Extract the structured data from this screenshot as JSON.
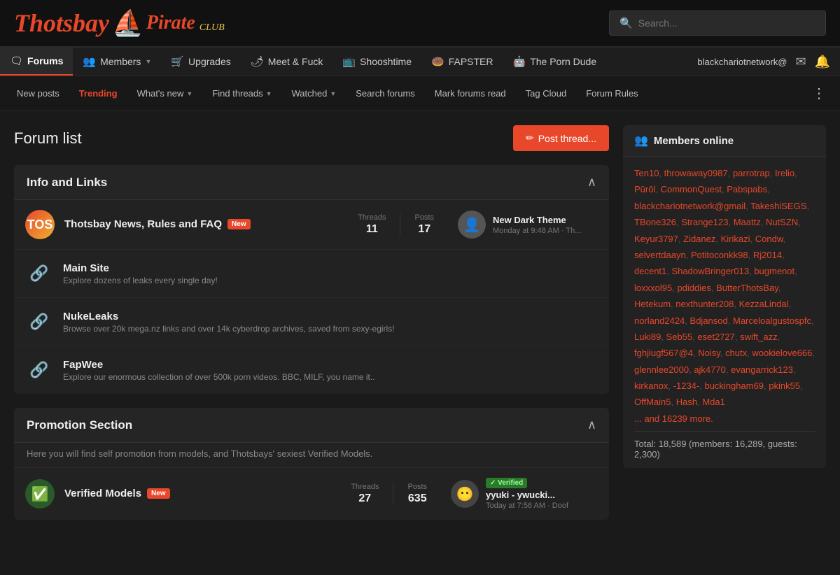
{
  "header": {
    "logo_part1": "Thotsbay",
    "logo_part2": "Pirate",
    "logo_part3": "CLUB",
    "search_placeholder": "Search..."
  },
  "navbar": {
    "items": [
      {
        "id": "forums",
        "label": "Forums",
        "icon": "🗨",
        "active": true
      },
      {
        "id": "members",
        "label": "Members",
        "icon": "👥",
        "has_arrow": true
      },
      {
        "id": "upgrades",
        "label": "Upgrades",
        "icon": "🛒"
      },
      {
        "id": "meet-fuck",
        "label": "Meet & Fuck",
        "icon": "🌶"
      },
      {
        "id": "shooshtime",
        "label": "Shooshtime",
        "icon": "📺"
      },
      {
        "id": "fapster",
        "label": "FAPSTER",
        "icon": "🍩"
      },
      {
        "id": "porn-dude",
        "label": "The Porn Dude",
        "icon": "🤖"
      }
    ],
    "username": "blackchariotnetwork@"
  },
  "sub_navbar": {
    "items": [
      {
        "id": "new-posts",
        "label": "New posts"
      },
      {
        "id": "trending",
        "label": "Trending",
        "active": true
      },
      {
        "id": "whats-new",
        "label": "What's new",
        "has_arrow": true
      },
      {
        "id": "find-threads",
        "label": "Find threads",
        "has_arrow": true
      },
      {
        "id": "watched",
        "label": "Watched",
        "has_arrow": true
      },
      {
        "id": "search-forums",
        "label": "Search forums"
      },
      {
        "id": "mark-read",
        "label": "Mark forums read"
      },
      {
        "id": "tag-cloud",
        "label": "Tag Cloud"
      },
      {
        "id": "forum-rules",
        "label": "Forum Rules"
      }
    ]
  },
  "page": {
    "title": "Forum list",
    "post_thread_btn": "Post thread..."
  },
  "sections": [
    {
      "id": "info-links",
      "title": "Info and Links",
      "collapsed": false,
      "forums": [
        {
          "id": "thotsbay-news",
          "name": "Thotsbay News, Rules and FAQ",
          "badge": "New",
          "threads": 11,
          "posts": 17,
          "latest_title": "New Dark Theme",
          "latest_meta": "Monday at 9:48 AM · Th...",
          "icon_type": "thotsb"
        }
      ],
      "links": [
        {
          "id": "main-site",
          "name": "Main Site",
          "desc": "Explore dozens of leaks every single day!"
        },
        {
          "id": "nukeleaks",
          "name": "NukeLeaks",
          "desc": "Browse over 20k mega.nz links and over 14k cyberdrop archives, saved from sexy-egirls!"
        },
        {
          "id": "fapwee",
          "name": "FapWee",
          "desc": "Explore our enormous collection of over 500k porn videos. BBC, MILF, you name it.."
        }
      ]
    },
    {
      "id": "promotion",
      "title": "Promotion Section",
      "desc": "Here you will find self promotion from models, and Thotsbays' sexiest Verified Models.",
      "collapsed": false,
      "forums": [
        {
          "id": "verified-models",
          "name": "Verified Models",
          "badge": "New",
          "threads": 27,
          "posts": 635,
          "latest_title": "yyuki - ywucki...",
          "latest_meta": "Today at 7:56 AM · Doof",
          "badge_type": "verified",
          "icon_type": "verified"
        }
      ]
    }
  ],
  "sidebar": {
    "members_online": {
      "title": "Members online",
      "members": [
        "Ten10",
        "throwaway0987",
        "parrotrap",
        "Irelio",
        "Pūrōl",
        "CommonQuest",
        "Pabspabs",
        "blackchariotnetwork@gmail",
        "TakeshiSEGS",
        "TBone326",
        "Strange123",
        "Maattz",
        "NutSZN",
        "Keyur3797",
        "Zidanez",
        "Kirikazi",
        "Condw",
        "selvertdaayn",
        "Potitoconkk98",
        "Rj2014",
        "decent1",
        "ShadowBringer013",
        "bugmenot",
        "loxxxol95",
        "pdiddies",
        "ButterThotsBay",
        "Hetekum",
        "nexthunter208",
        "KezzaLindal",
        "norland2424",
        "Bdjansod",
        "Marceloalgustospfc",
        "Luki89",
        "Seb55",
        "eset2727",
        "swift_azz",
        "fghjiugf567@4",
        "Noisy",
        "chutx",
        "wookielove666",
        "glennlee2000",
        "ajk4770",
        "evangarrick123",
        "kirkanox",
        "-1234-",
        "buckingham69",
        "pkink55",
        "OffMain5",
        "Hash",
        "Mda1"
      ],
      "more_text": "... and 16239 more.",
      "total": "Total: 18,589 (members: 16,289, guests: 2,300)"
    }
  }
}
